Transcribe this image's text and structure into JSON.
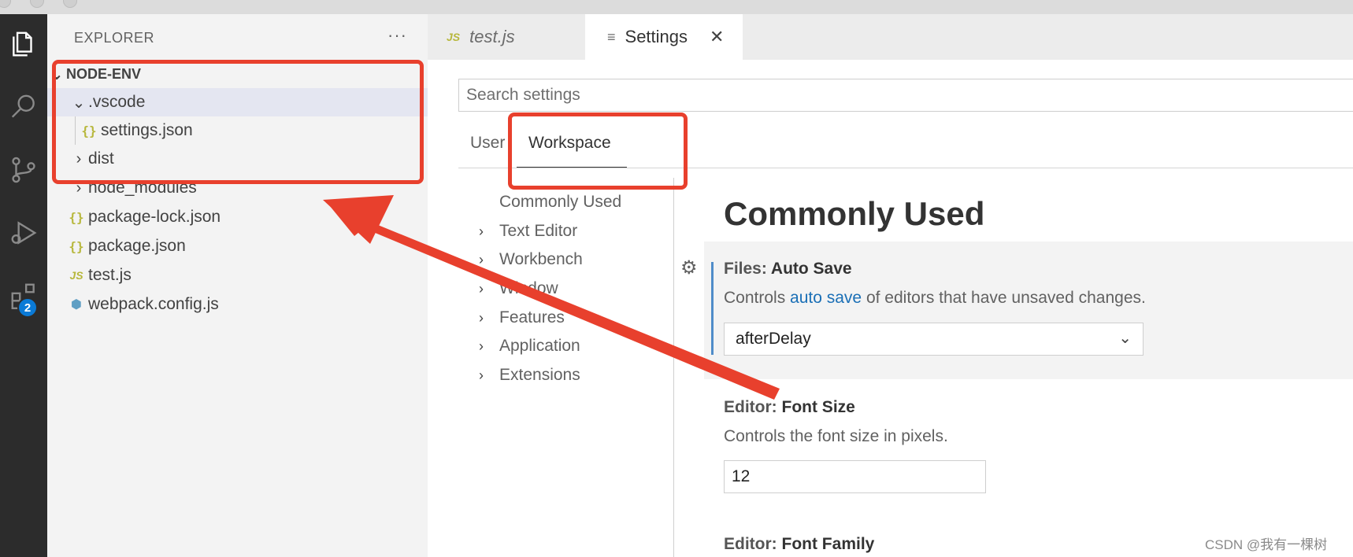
{
  "explorer": {
    "title": "EXPLORER",
    "more": "···",
    "root": "NODE-ENV",
    "items": [
      {
        "label": ".vscode",
        "type": "folder-open"
      },
      {
        "label": "settings.json",
        "type": "json"
      },
      {
        "label": "dist",
        "type": "folder"
      },
      {
        "label": "node_modules",
        "type": "folder"
      },
      {
        "label": "package-lock.json",
        "type": "json"
      },
      {
        "label": "package.json",
        "type": "json"
      },
      {
        "label": "test.js",
        "type": "js"
      },
      {
        "label": "webpack.config.js",
        "type": "webpack"
      }
    ],
    "json_glyph": "{}",
    "js_glyph": "JS"
  },
  "activity": {
    "items": [
      "files-icon",
      "search-icon",
      "source-control-icon",
      "run-debug-icon",
      "extensions-icon"
    ],
    "badge": "2"
  },
  "tabs": [
    {
      "label": "test.js",
      "icon": "JS"
    },
    {
      "label": "Settings",
      "icon": "≡",
      "close": "✕"
    }
  ],
  "settings": {
    "search_placeholder": "Search settings",
    "scopes": [
      "User",
      "Workspace"
    ],
    "toc": [
      {
        "label": "Commonly Used",
        "chevron": ""
      },
      {
        "label": "Text Editor",
        "chevron": "›"
      },
      {
        "label": "Workbench",
        "chevron": "›"
      },
      {
        "label": "Window",
        "chevron": "›"
      },
      {
        "label": "Features",
        "chevron": "›"
      },
      {
        "label": "Application",
        "chevron": "›"
      },
      {
        "label": "Extensions",
        "chevron": "›"
      }
    ],
    "heading": "Commonly Used",
    "auto_save": {
      "category": "Files: ",
      "name": "Auto Save",
      "desc_before": "Controls ",
      "desc_link": "auto save",
      "desc_after": " of editors that have unsaved changes.",
      "value": "afterDelay",
      "dropdown_glyph": "⌄"
    },
    "font_size": {
      "category": "Editor: ",
      "name": "Font Size",
      "desc": "Controls the font size in pixels.",
      "value": "12"
    },
    "font_family": {
      "category": "Editor: ",
      "name": "Font Family"
    }
  },
  "annotation": {
    "color": "#e8402d"
  },
  "watermark": "CSDN @我有一棵树"
}
